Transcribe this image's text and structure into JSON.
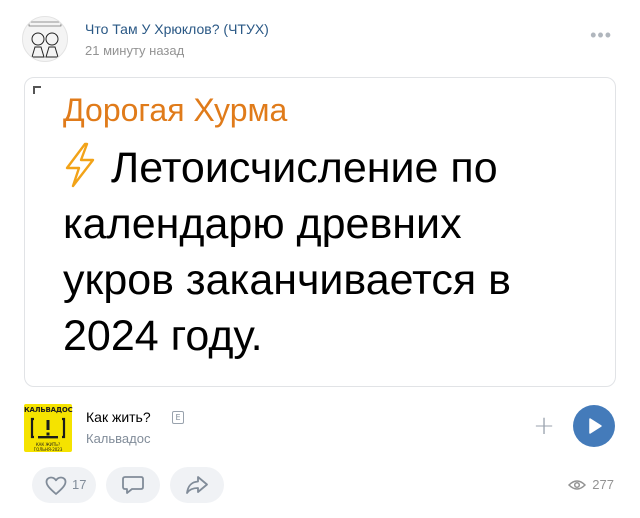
{
  "post": {
    "group_name": "Что Там У Хрюклов? (ЧТУХ)",
    "time": "21 минуту назад",
    "avatar_caption": "что там у хрюклов"
  },
  "image": {
    "title": "Дорогая Хурма",
    "body_lines": [
      "Летоисчисление по",
      "календарю древних",
      "укров заканчивается в",
      "2024 году."
    ]
  },
  "audio": {
    "title": "Как жить?",
    "explicit_badge": "E",
    "artist": "Кальвадос",
    "cover_top": "КАЛЬВАДОС",
    "cover_bottom": "КАК ЖИТЬ? ГОЛЬНЯ-2023"
  },
  "actions": {
    "likes": "17",
    "views": "277"
  },
  "colors": {
    "accent": "#447bba",
    "title_orange": "#e07b1a",
    "link": "#2a5885",
    "muted": "#818c99"
  }
}
